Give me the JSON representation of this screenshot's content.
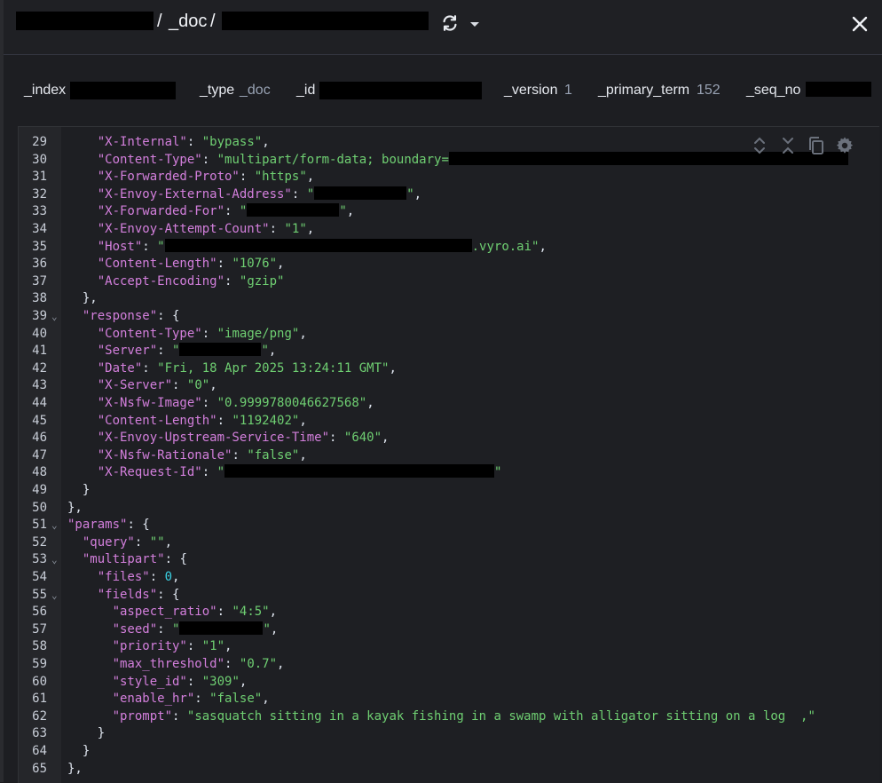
{
  "header": {
    "separator_1": "/",
    "doc_type": "_doc",
    "separator_2": "/"
  },
  "meta": {
    "index_label": "_index",
    "type_label": "_type",
    "type_value": "_doc",
    "id_label": "_id",
    "version_label": "_version",
    "version_value": "1",
    "primary_term_label": "_primary_term",
    "primary_term_value": "152",
    "seq_no_label": "_seq_no"
  },
  "icons": {
    "refresh": "refresh-icon",
    "dropdown": "chevron-down-icon",
    "close": "close-icon",
    "expand": "expand-icon",
    "collapse": "collapse-icon",
    "copy": "copy-icon",
    "settings": "gear-icon"
  },
  "code": {
    "lines": [
      {
        "n": "29",
        "t": "    \"X-Internal\": \"bypass\","
      },
      {
        "n": "30",
        "t": "    \"Content-Type\": \"multipart/form-data; boundary="
      },
      {
        "n": "31",
        "t": "    \"X-Forwarded-Proto\": \"https\","
      },
      {
        "n": "32",
        "t": "    \"X-Envoy-External-Address\": \""
      },
      {
        "n": "33",
        "t": "    \"X-Forwarded-For\": \""
      },
      {
        "n": "34",
        "t": "    \"X-Envoy-Attempt-Count\": \"1\","
      },
      {
        "n": "35",
        "t": "    \"Host\": \""
      },
      {
        "n": "36",
        "t": "    \"Content-Length\": \"1076\","
      },
      {
        "n": "37",
        "t": "    \"Accept-Encoding\": \"gzip\""
      },
      {
        "n": "38",
        "t": "  },"
      },
      {
        "n": "39",
        "t": "  \"response\": {"
      },
      {
        "n": "40",
        "t": "    \"Content-Type\": \"image/png\","
      },
      {
        "n": "41",
        "t": "    \"Server\": \""
      },
      {
        "n": "42",
        "t": "    \"Date\": \"Fri, 18 Apr 2025 13:24:11 GMT\","
      },
      {
        "n": "43",
        "t": "    \"X-Server\": \"0\","
      },
      {
        "n": "44",
        "t": "    \"X-Nsfw-Image\": \"0.9999780046627568\","
      },
      {
        "n": "45",
        "t": "    \"Content-Length\": \"1192402\","
      },
      {
        "n": "46",
        "t": "    \"X-Envoy-Upstream-Service-Time\": \"640\","
      },
      {
        "n": "47",
        "t": "    \"X-Nsfw-Rationale\": \"false\","
      },
      {
        "n": "48",
        "t": "    \"X-Request-Id\": \""
      },
      {
        "n": "49",
        "t": "  }"
      },
      {
        "n": "50",
        "t": "},"
      },
      {
        "n": "51",
        "t": "\"params\": {"
      },
      {
        "n": "52",
        "t": "  \"query\": \"\","
      },
      {
        "n": "53",
        "t": "  \"multipart\": {"
      },
      {
        "n": "54",
        "t": "    \"files\": 0,"
      },
      {
        "n": "55",
        "t": "    \"fields\": {"
      },
      {
        "n": "56",
        "t": "      \"aspect_ratio\": \"4:5\","
      },
      {
        "n": "57",
        "t": "      \"seed\": \""
      },
      {
        "n": "58",
        "t": "      \"priority\": \"1\","
      },
      {
        "n": "59",
        "t": "      \"max_threshold\": \"0.7\","
      },
      {
        "n": "60",
        "t": "      \"style_id\": \"309\","
      },
      {
        "n": "61",
        "t": "      \"enable_hr\": \"false\","
      },
      {
        "n": "62",
        "t": "      \"prompt\": \"sasquatch sitting in a kayak fishing in a swamp with alligator sitting on a log  ,\""
      },
      {
        "n": "63",
        "t": "    }"
      },
      {
        "n": "64",
        "t": "  }"
      },
      {
        "n": "65",
        "t": "},"
      }
    ],
    "host_suffix": ".vyro.ai\",",
    "fold_lines": [
      "39",
      "51",
      "53",
      "55"
    ]
  },
  "colors": {
    "key": "#d37fdc",
    "string": "#6fcf72",
    "number": "#3ad1e3",
    "background": "#1e1f23"
  }
}
